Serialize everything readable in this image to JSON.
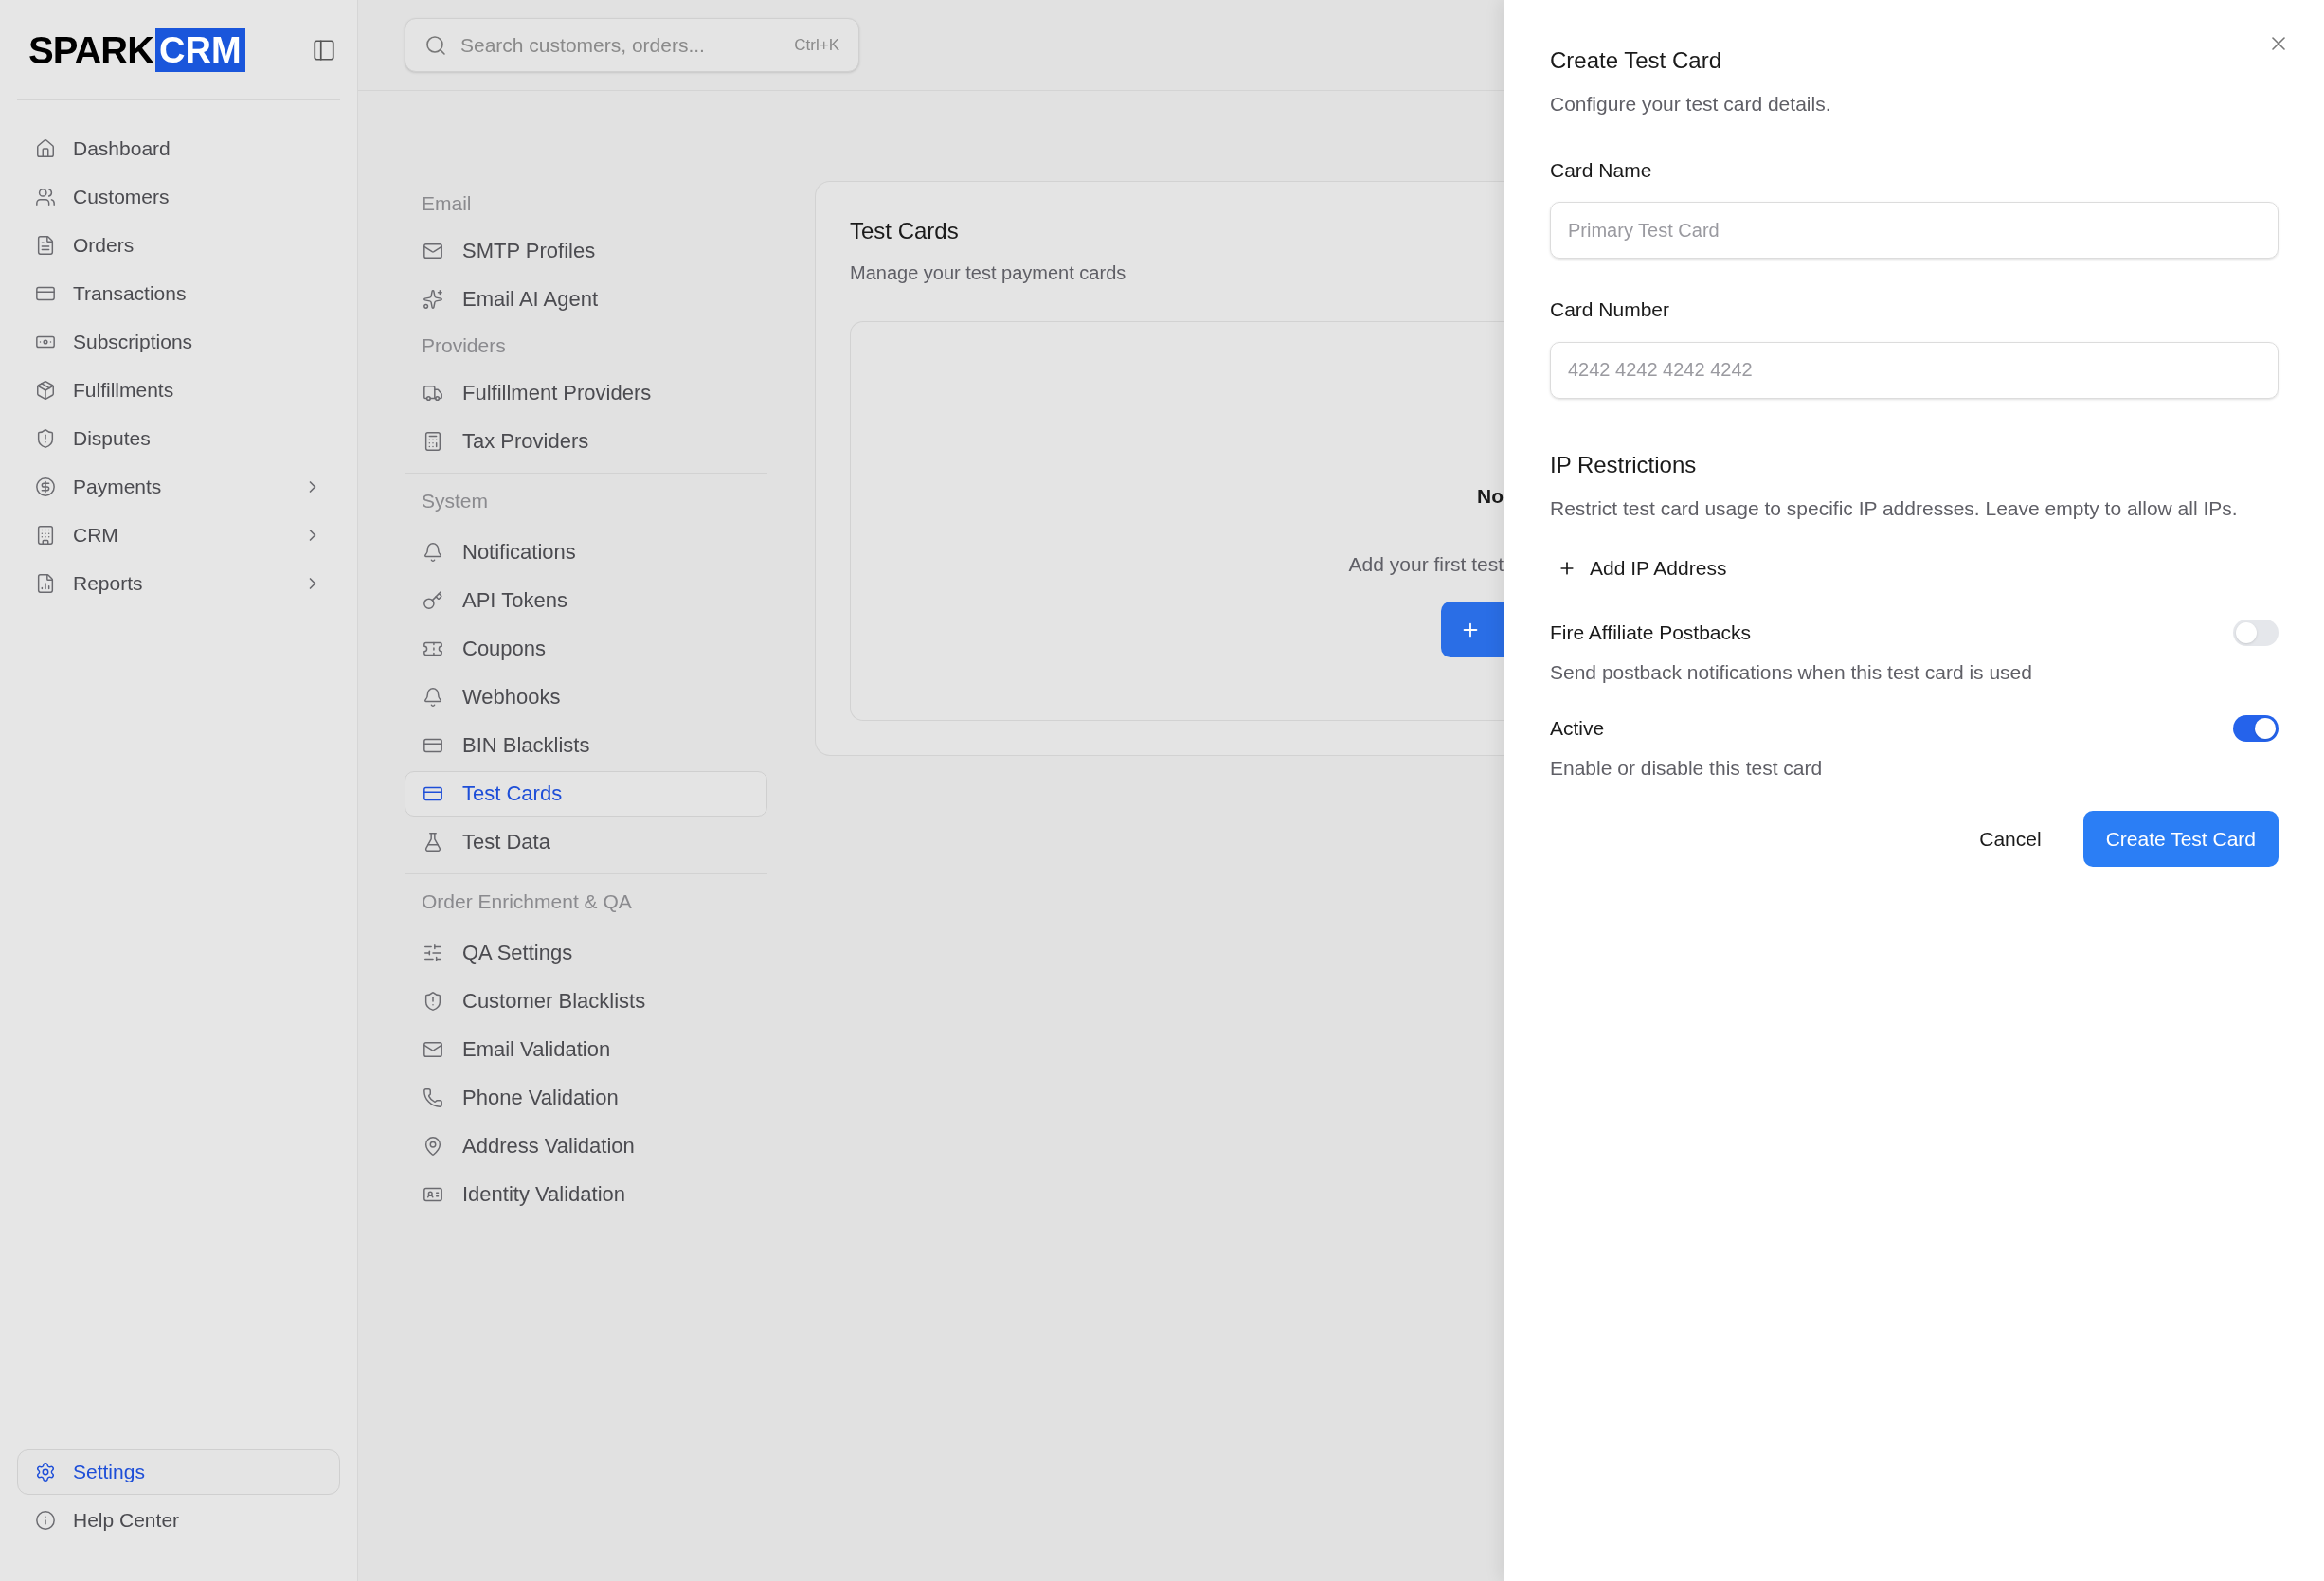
{
  "sidebar": {
    "logo": {
      "part_1": "SPARK",
      "part_2": "CRM"
    },
    "items": [
      {
        "label": "Dashboard",
        "selected": false,
        "has_submenu": false
      },
      {
        "label": "Customers",
        "selected": false,
        "has_submenu": false
      },
      {
        "label": "Orders",
        "selected": false,
        "has_submenu": false
      },
      {
        "label": "Transactions",
        "selected": false,
        "has_submenu": false
      },
      {
        "label": "Subscriptions",
        "selected": false,
        "has_submenu": false
      },
      {
        "label": "Fulfillments",
        "selected": false,
        "has_submenu": false
      },
      {
        "label": "Disputes",
        "selected": false,
        "has_submenu": false
      },
      {
        "label": "Payments",
        "selected": false,
        "has_submenu": true
      },
      {
        "label": "CRM",
        "selected": false,
        "has_submenu": true
      },
      {
        "label": "Reports",
        "selected": false,
        "has_submenu": true
      }
    ],
    "footer_items": [
      {
        "label": "Settings",
        "selected": true
      },
      {
        "label": "Help Center",
        "selected": false
      }
    ]
  },
  "search": {
    "placeholder": "Search customers, orders...",
    "shortcut": "Ctrl+K"
  },
  "settings_nav": {
    "groups": [
      {
        "heading": "Email",
        "divider": false,
        "items": [
          {
            "label": "SMTP Profiles",
            "selected": false
          },
          {
            "label": "Email AI Agent",
            "selected": false
          }
        ]
      },
      {
        "heading": "Providers",
        "divider": false,
        "items": [
          {
            "label": "Fulfillment Providers",
            "selected": false
          },
          {
            "label": "Tax Providers",
            "selected": false
          }
        ]
      },
      {
        "heading": "System",
        "divider": true,
        "items": [
          {
            "label": "Notifications",
            "selected": false
          },
          {
            "label": "API Tokens",
            "selected": false
          },
          {
            "label": "Coupons",
            "selected": false
          },
          {
            "label": "Webhooks",
            "selected": false
          },
          {
            "label": "BIN Blacklists",
            "selected": false
          },
          {
            "label": "Test Cards",
            "selected": true
          },
          {
            "label": "Test Data",
            "selected": false
          }
        ]
      },
      {
        "heading": "Order Enrichment & QA",
        "divider": true,
        "items": [
          {
            "label": "QA Settings",
            "selected": false
          },
          {
            "label": "Customer Blacklists",
            "selected": false
          },
          {
            "label": "Email Validation",
            "selected": false
          },
          {
            "label": "Phone Validation",
            "selected": false
          },
          {
            "label": "Address Validation",
            "selected": false
          },
          {
            "label": "Identity Validation",
            "selected": false
          }
        ]
      }
    ]
  },
  "card": {
    "title": "Test Cards",
    "subtitle": "Manage your test payment cards",
    "empty_state": {
      "title": "No",
      "text": "Add your first test"
    }
  },
  "dialog": {
    "title": "Create Test Card",
    "subtitle": "Configure your test card details.",
    "fields": [
      {
        "label": "Card Name",
        "placeholder": "Primary Test Card"
      },
      {
        "label": "Card Number",
        "placeholder": "4242 4242 4242 4242"
      }
    ],
    "ip_section": {
      "title": "IP Restrictions",
      "description": "Restrict test card usage to specific IP addresses. Leave empty to allow all IPs.",
      "add_button": "Add IP Address"
    },
    "toggles": [
      {
        "label": "Fire Affiliate Postbacks",
        "description": "Send postback notifications when this test card is used",
        "on": false
      },
      {
        "label": "Active",
        "description": "Enable or disable this test card",
        "on": true
      }
    ],
    "buttons": [
      {
        "label": "Cancel",
        "kind": "secondary"
      },
      {
        "label": "Create Test Card",
        "kind": "primary"
      }
    ]
  }
}
